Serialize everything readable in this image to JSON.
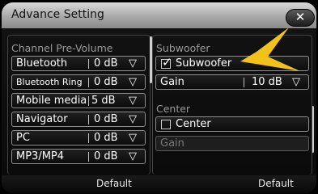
{
  "header": {
    "title": "Advance Setting",
    "close_label": "✕"
  },
  "left": {
    "section_title": "Channel Pre-Volume",
    "rows": [
      {
        "label": "Bluetooth",
        "value": "0 dB"
      },
      {
        "label": "Bluetooth Ring",
        "value": "0 dB"
      },
      {
        "label": "Mobile media",
        "value": "5 dB"
      },
      {
        "label": "Navigator",
        "value": "0 dB"
      },
      {
        "label": "PC",
        "value": "0 dB"
      },
      {
        "label": "MP3/MP4",
        "value": "0 dB"
      }
    ]
  },
  "right": {
    "subwoofer": {
      "section_title": "Subwoofer",
      "toggle_label": "Subwoofer",
      "toggle_checked": true,
      "gain_label": "Gain",
      "gain_value": "10 dB"
    },
    "center": {
      "section_title": "Center",
      "toggle_label": "Center",
      "toggle_checked": false,
      "gain_label": "Gain"
    }
  },
  "footer": {
    "left_default": "Default",
    "right_default": "Default"
  },
  "colors": {
    "callout_arrow": "#f2c21a",
    "title_bar": "#b5b5b5",
    "border": "#8e8e8e"
  },
  "icons": {
    "close": "close-icon",
    "dropdown": "triangle-down-icon",
    "checkbox": "checkbox-icon"
  }
}
